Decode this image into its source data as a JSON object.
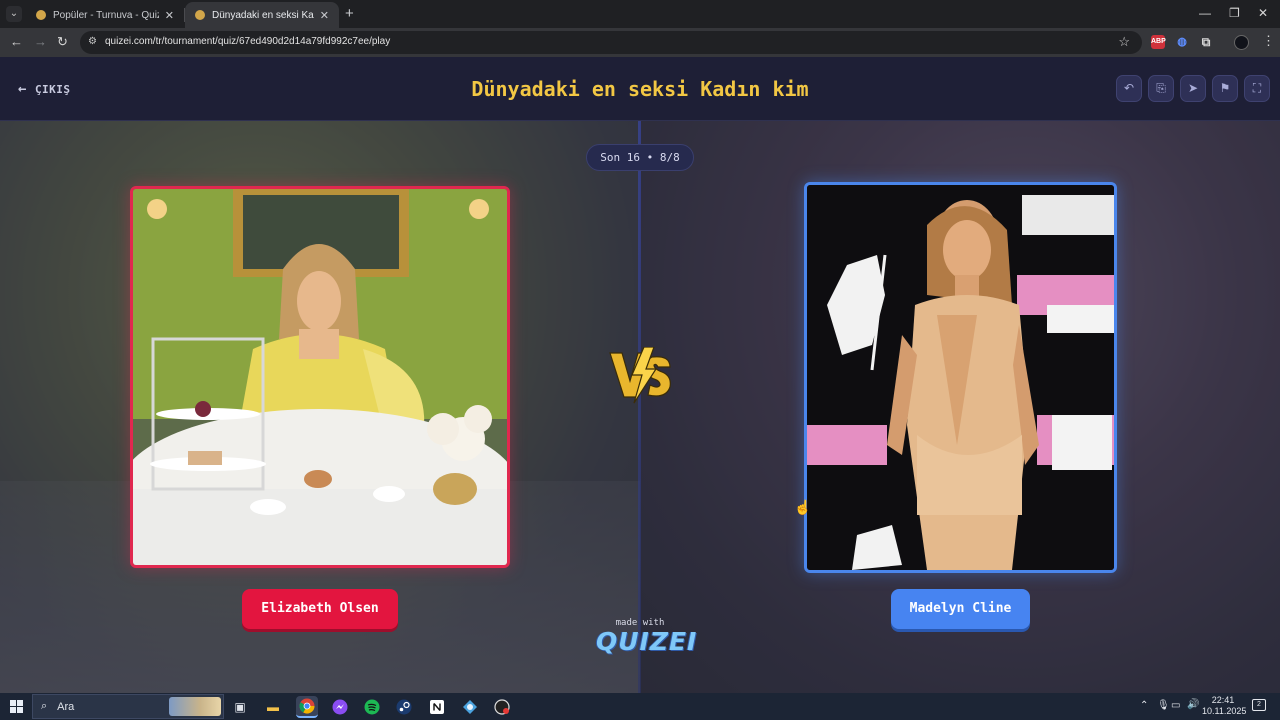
{
  "browser": {
    "tabs": [
      {
        "title": "Popüler - Turnuva - Quizei",
        "active": false
      },
      {
        "title": "Dünyadaki en seksi Kadın kim",
        "active": true
      }
    ],
    "url": "quizei.com/tr/tournament/quiz/67ed490d2d14a79fd992c7ee/play",
    "extensions": {
      "abp": "ABP"
    }
  },
  "app": {
    "exit_label": "ÇIKIŞ",
    "title": "Dünyadaki en seksi Kadın kim",
    "round_badge": "Son 16 • 8/8",
    "made_with": "made with",
    "brand": "QUIZEI",
    "contestants": [
      {
        "name": "Elizabeth Olsen",
        "color": "#e3153f"
      },
      {
        "name": "Madelyn Cline",
        "color": "#4784f1"
      }
    ],
    "header_buttons": [
      "undo-icon",
      "share-icon",
      "send-icon",
      "flag-icon",
      "fullscreen-icon"
    ]
  },
  "taskbar": {
    "search_placeholder": "Ara",
    "clock_time": "22:41",
    "clock_date": "10.11.2025",
    "notification_count": "2",
    "apps": [
      "task-view-icon",
      "file-explorer-icon",
      "chrome-icon",
      "messenger-icon",
      "spotify-icon",
      "steam-icon",
      "notion-icon",
      "app-icon",
      "app-icon"
    ]
  },
  "colors": {
    "title": "#f2c744",
    "header_bg": "#1e1f36",
    "left_accent": "#e0284f",
    "right_accent": "#4a86ec"
  }
}
